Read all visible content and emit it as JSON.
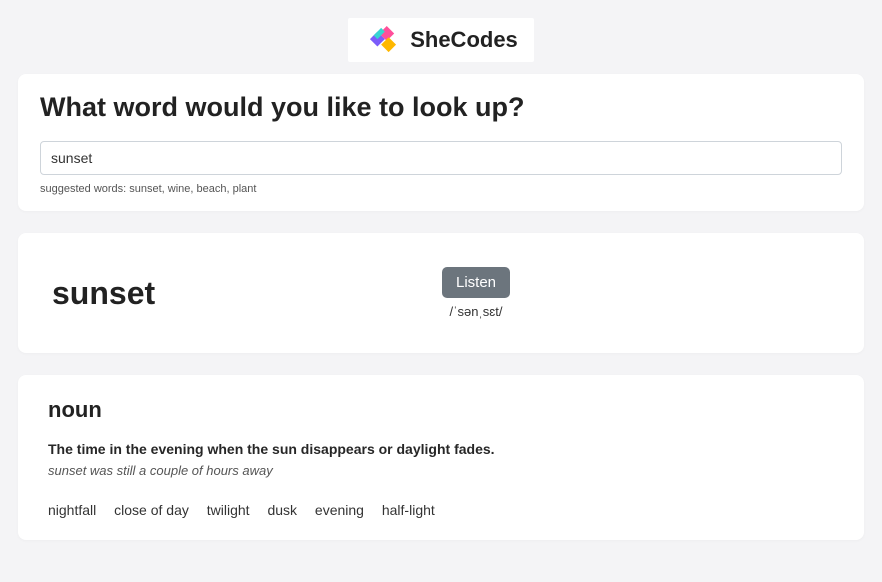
{
  "brand": {
    "name": "SheCodes"
  },
  "search": {
    "heading": "What word would you like to look up?",
    "value": "sunset",
    "suggested": "suggested words: sunset, wine, beach, plant"
  },
  "result": {
    "word": "sunset",
    "listen_label": "Listen",
    "phonetic": "/ˈsənˌsɛt/"
  },
  "meaning": {
    "part_of_speech": "noun",
    "definition": "The time in the evening when the sun disappears or daylight fades.",
    "example": "sunset was still a couple of hours away",
    "synonyms": [
      "nightfall",
      "close of day",
      "twilight",
      "dusk",
      "evening",
      "half-light"
    ]
  }
}
